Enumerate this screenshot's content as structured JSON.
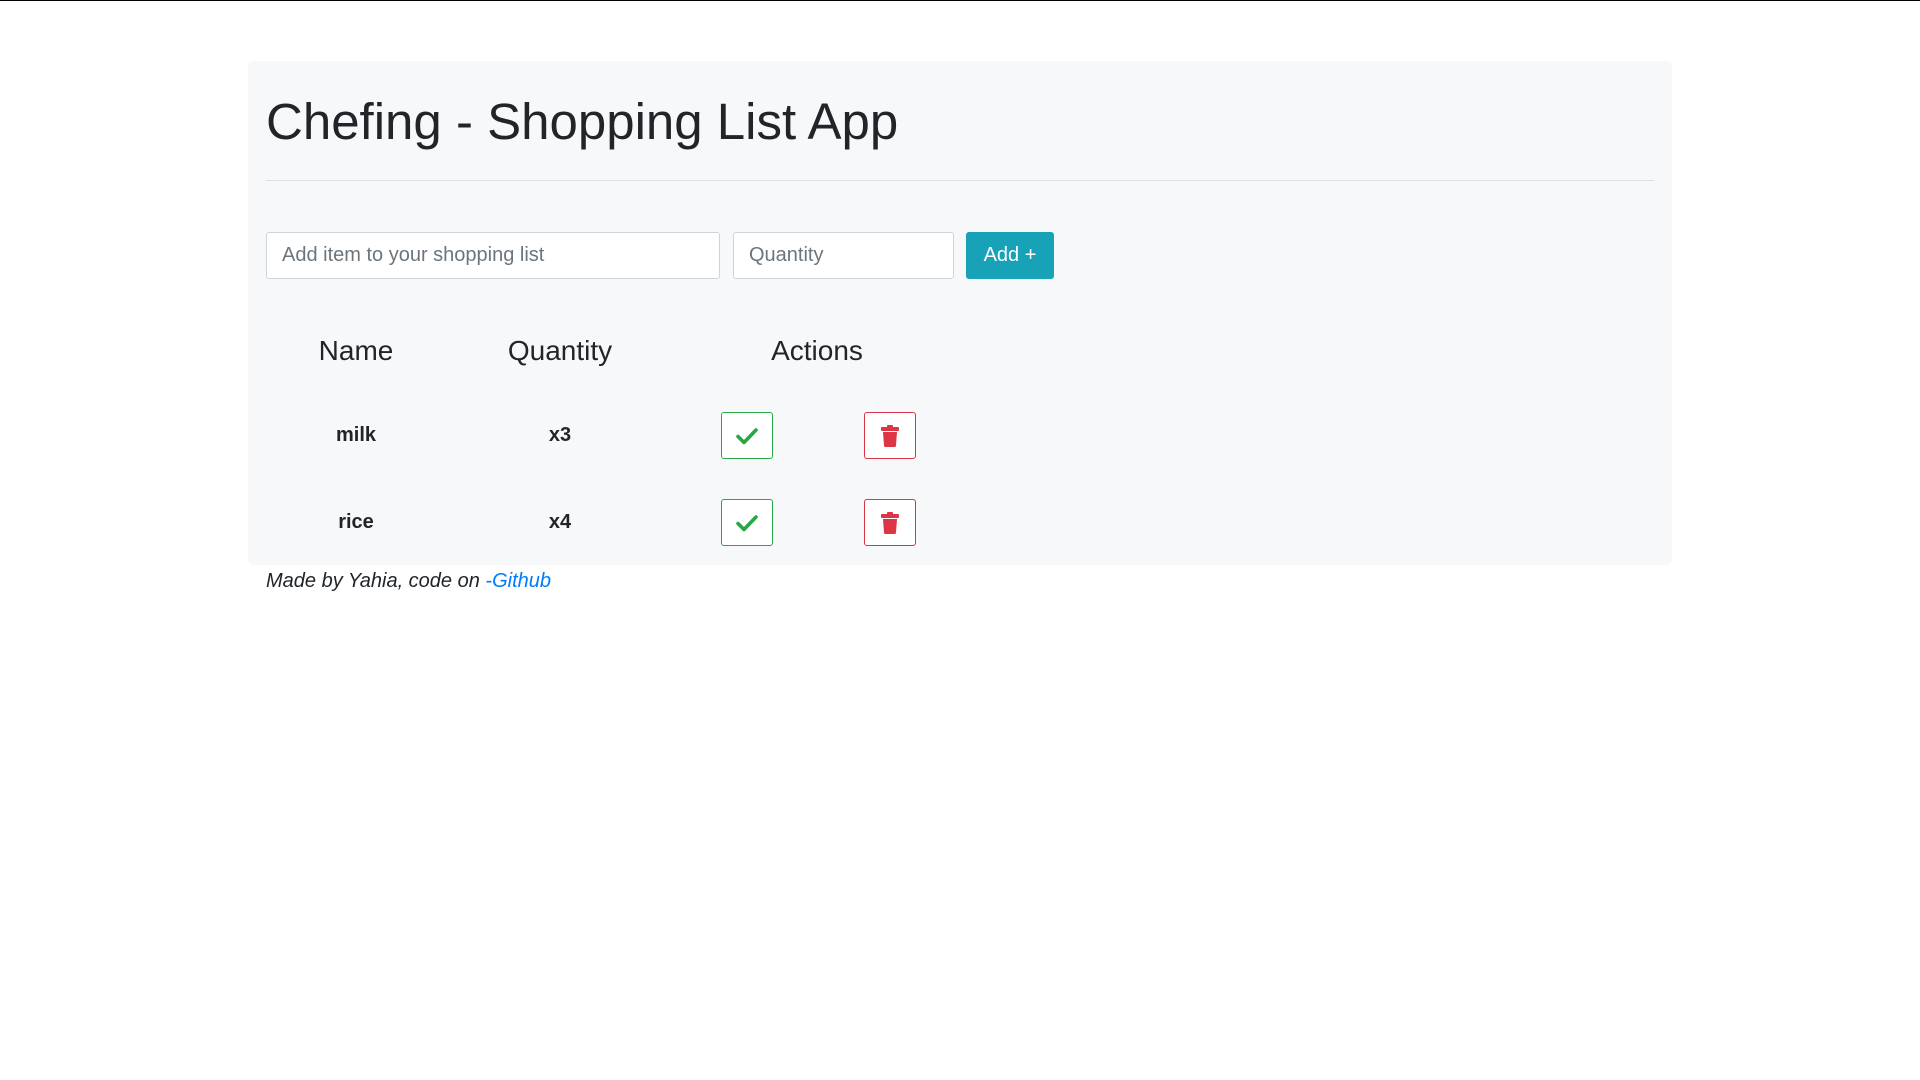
{
  "app": {
    "title": "Chefing - Shopping List App"
  },
  "form": {
    "item_placeholder": "Add item to your shopping list",
    "item_value": "",
    "quantity_placeholder": "Quantity",
    "quantity_value": "",
    "add_label": "Add +"
  },
  "table": {
    "headers": [
      "Name",
      "Quantity",
      "Actions"
    ],
    "rows": [
      {
        "name": "milk",
        "quantity": "x3"
      },
      {
        "name": "rice",
        "quantity": "x4"
      }
    ]
  },
  "footer": {
    "text": "Made by Yahia, code on ",
    "link_label": "-Github"
  },
  "icons": {
    "done": "checkmark-icon",
    "delete": "trash-icon"
  },
  "colors": {
    "accent": "#17a2b8",
    "success": "#28a745",
    "danger": "#dc3545",
    "link": "#007bff",
    "panel": "#f7f8f9"
  }
}
